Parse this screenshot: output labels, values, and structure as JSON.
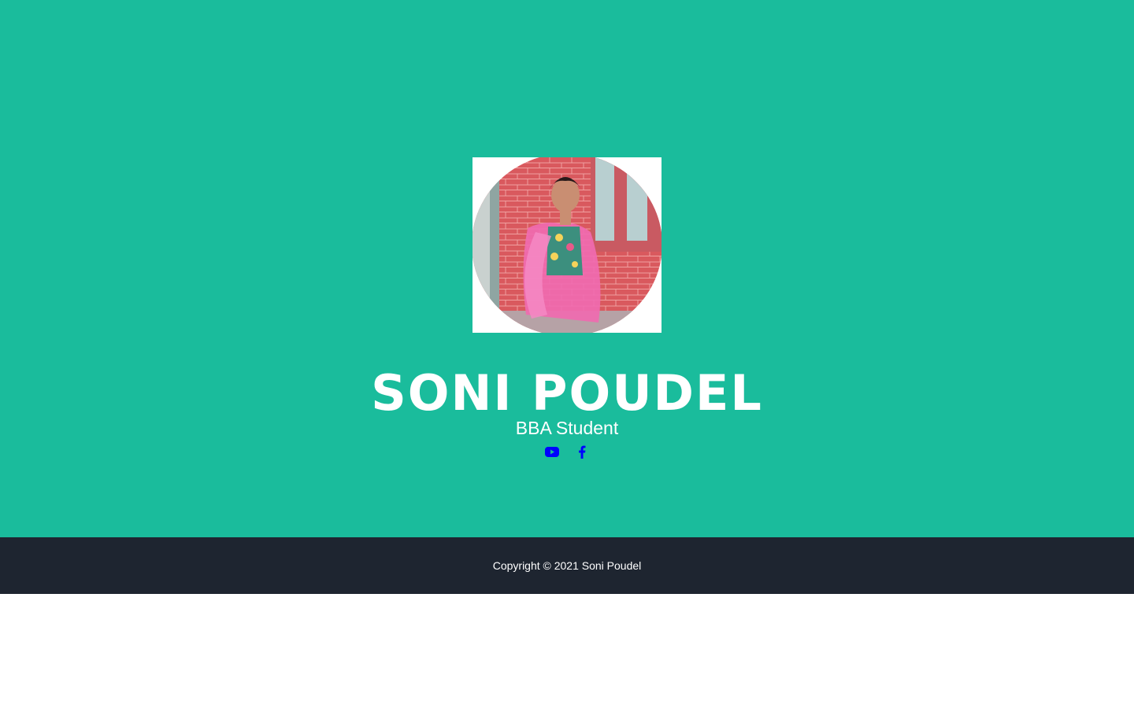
{
  "profile": {
    "name": "SONI POUDEL",
    "role": "BBA Student"
  },
  "social": [
    {
      "icon": "youtube-icon",
      "color": "#0000ff"
    },
    {
      "icon": "facebook-icon",
      "color": "#0000ff"
    }
  ],
  "footer": {
    "copyright": "Copyright © 2021 Soni Poudel"
  },
  "colors": {
    "hero_bg": "#1abc9c",
    "footer_bg": "#1e2530",
    "text": "#ffffff",
    "link": "#0000ff"
  }
}
